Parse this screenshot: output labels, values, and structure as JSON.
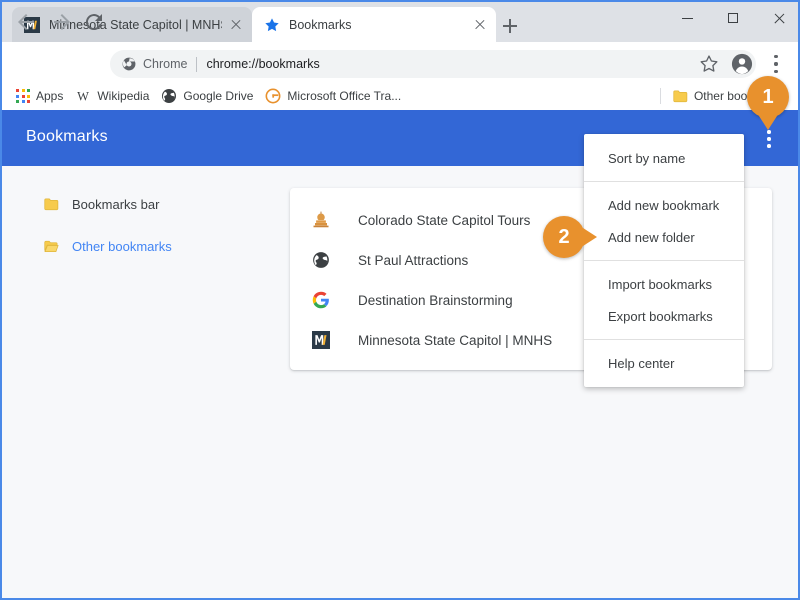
{
  "window": {
    "controls": {
      "minimize": "minimize-icon",
      "maximize": "maximize-icon",
      "close": "close-icon"
    }
  },
  "tabstrip": {
    "tabs": [
      {
        "title": "Minnesota State Capitol | MNHS",
        "favicon": "mnhs-favicon",
        "active": false
      },
      {
        "title": "Bookmarks",
        "favicon": "star-icon",
        "active": true
      }
    ],
    "new_tab_label": "+"
  },
  "toolbar": {
    "back_label": "Back",
    "forward_label": "Forward",
    "reload_label": "Reload",
    "omnibox": {
      "scheme_chip": "Chrome",
      "url": "chrome://bookmarks",
      "chip_icon": "chrome-logo-icon"
    },
    "star_label": "Bookmark this tab",
    "profile_label": "Profile",
    "menu_label": "Customize and control Google Chrome"
  },
  "bookmarks_bar": {
    "items": [
      {
        "label": "Apps",
        "icon": "apps-grid-icon"
      },
      {
        "label": "Wikipedia",
        "icon": "wikipedia-w-icon"
      },
      {
        "label": "Google Drive",
        "icon": "globe-icon"
      },
      {
        "label": "Microsoft Office Tra...",
        "icon": "office-c-icon"
      }
    ],
    "other_bookmarks": {
      "label": "Other bookmarks",
      "icon": "folder-icon"
    }
  },
  "page": {
    "header": {
      "title": "Bookmarks",
      "menu_label": "Organize",
      "bg_color": "#3367d6"
    },
    "sidebar": {
      "items": [
        {
          "label": "Bookmarks bar",
          "icon": "folder-icon",
          "selected": false
        },
        {
          "label": "Other bookmarks",
          "icon": "folder-open-icon",
          "selected": true
        }
      ]
    },
    "bookmark_list": [
      {
        "label": "Colorado State Capitol Tours",
        "icon": "capitol-dome-icon"
      },
      {
        "label": "St Paul Attractions",
        "icon": "globe-icon"
      },
      {
        "label": "Destination Brainstorming",
        "icon": "google-g-icon"
      },
      {
        "label": "Minnesota State Capitol | MNHS",
        "icon": "mnhs-favicon"
      }
    ]
  },
  "dropdown_menu": {
    "groups": [
      {
        "items": [
          "Sort by name"
        ]
      },
      {
        "items": [
          "Add new bookmark",
          "Add new folder"
        ]
      },
      {
        "items": [
          "Import bookmarks",
          "Export bookmarks"
        ]
      },
      {
        "items": [
          "Help center"
        ]
      }
    ],
    "flat_items": [
      "Sort by name",
      "Add new bookmark",
      "Add new folder",
      "Import bookmarks",
      "Export bookmarks",
      "Help center"
    ]
  },
  "callouts": [
    {
      "number": "1",
      "target": "other-bookmarks-menu",
      "color": "#e8912d"
    },
    {
      "number": "2",
      "target": "add-new-folder",
      "color": "#e8912d"
    }
  ]
}
